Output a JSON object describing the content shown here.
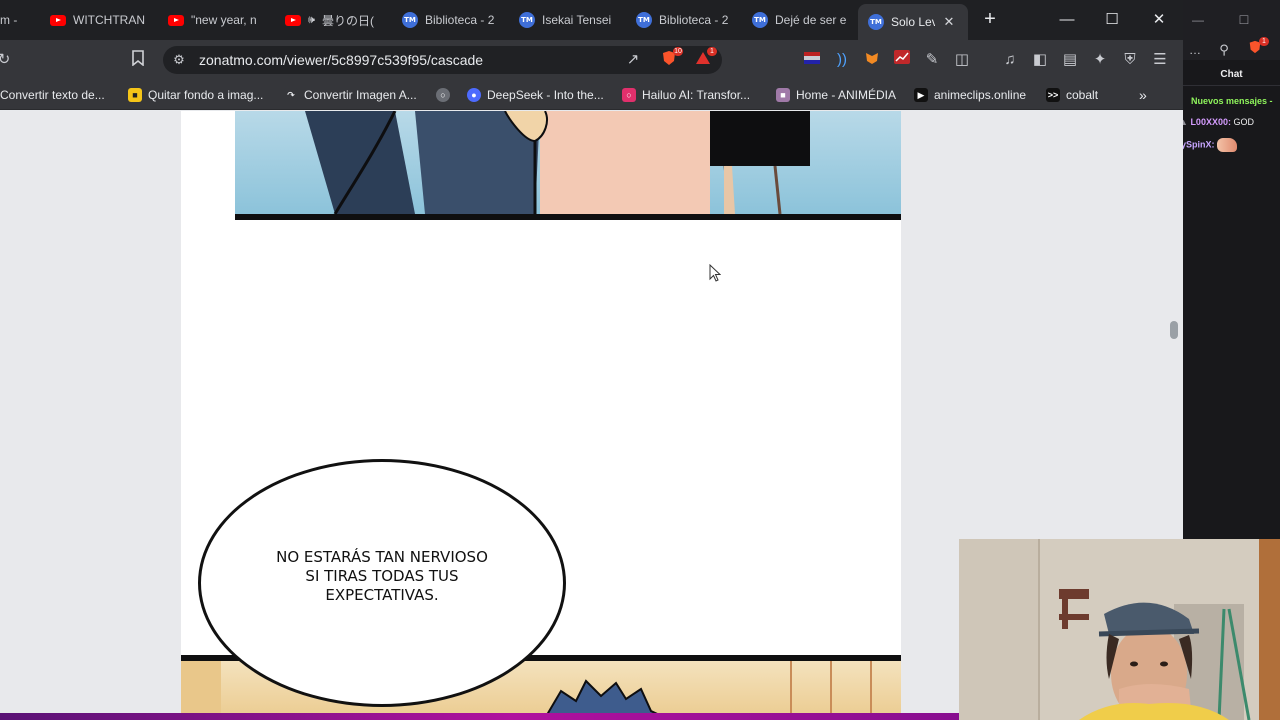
{
  "tabs": [
    {
      "title": "m -",
      "icon": "youtube-icon"
    },
    {
      "title": "WITCHTRAN",
      "icon": "youtube-icon"
    },
    {
      "title": "\"new year, n",
      "icon": "youtube-icon"
    },
    {
      "title": "曇りの日(",
      "icon": "youtube-icon"
    },
    {
      "title": "Biblioteca - 2",
      "icon": "tmo-icon"
    },
    {
      "title": "Isekai Tensei",
      "icon": "tmo-icon"
    },
    {
      "title": "Biblioteca - 2",
      "icon": "tmo-icon"
    },
    {
      "title": "Dejé de ser e",
      "icon": "tmo-icon"
    },
    {
      "title": "Solo Lev",
      "icon": "tmo-icon",
      "active": true
    }
  ],
  "address_bar": {
    "url": "zonatmo.com/viewer/5c8997c539f95/cascade"
  },
  "toolbar_badges": {
    "brave_shields": "10",
    "brave_rewards": "1",
    "chat_extension": "1"
  },
  "bookmarks": [
    {
      "label": "Convertir texto de..."
    },
    {
      "label": "Quitar fondo a imag..."
    },
    {
      "label": "Convertir Imagen A..."
    },
    {
      "label": ""
    },
    {
      "label": "DeepSeek - Into the..."
    },
    {
      "label": "Hailuo AI: Transfor..."
    },
    {
      "label": "Home - ANIMÉDIA"
    },
    {
      "label": "animeclips.online"
    },
    {
      "label": "cobalt"
    }
  ],
  "manga": {
    "speech_bubble": "NO ESTARÁS TAN NERVIOSO\nSI TIRAS TODAS TUS\nEXPECTATIVAS."
  },
  "chat": {
    "title": "Chat",
    "new_messages": "Nuevos mensajes",
    "messages": [
      {
        "user": "L00XX00:",
        "text": "GOD"
      },
      {
        "user": "ySpinX:",
        "text": ""
      }
    ]
  },
  "colors": {
    "tabstrip": "#1f2023",
    "toolbar": "#35363a",
    "chat_bg": "#18181b",
    "new_messages": "#8ff45c"
  }
}
